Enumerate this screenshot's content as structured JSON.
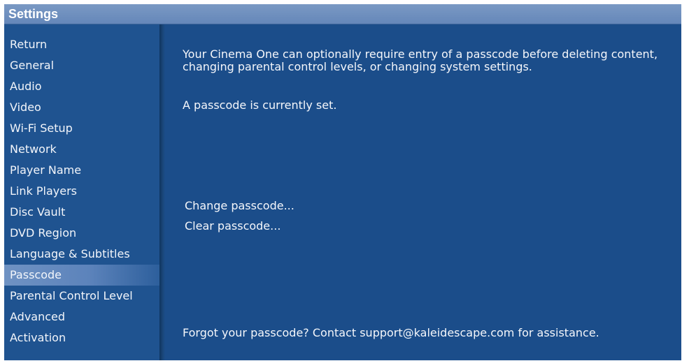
{
  "window": {
    "title": "Settings"
  },
  "sidebar": {
    "items": [
      {
        "label": "Return"
      },
      {
        "label": "General"
      },
      {
        "label": "Audio"
      },
      {
        "label": "Video"
      },
      {
        "label": "Wi-Fi Setup"
      },
      {
        "label": "Network"
      },
      {
        "label": "Player Name"
      },
      {
        "label": "Link Players"
      },
      {
        "label": "Disc Vault"
      },
      {
        "label": "DVD Region"
      },
      {
        "label": "Language & Subtitles"
      },
      {
        "label": "Passcode"
      },
      {
        "label": "Parental Control Level"
      },
      {
        "label": "Advanced"
      },
      {
        "label": "Activation"
      }
    ],
    "selected": "Passcode"
  },
  "main": {
    "description": "Your Cinema One can optionally require entry of a passcode before deleting content, changing parental control levels, or changing system settings.",
    "status": "A passcode is currently set.",
    "actions": [
      {
        "label": "Change passcode..."
      },
      {
        "label": "Clear passcode..."
      }
    ],
    "footer": "Forgot your passcode? Contact support@kaleidescape.com for assistance."
  },
  "colors": {
    "background": "#1b4d8a",
    "titlebar": "#6d8ebf",
    "selection": "#6f92c3",
    "text": "#ffffff"
  }
}
